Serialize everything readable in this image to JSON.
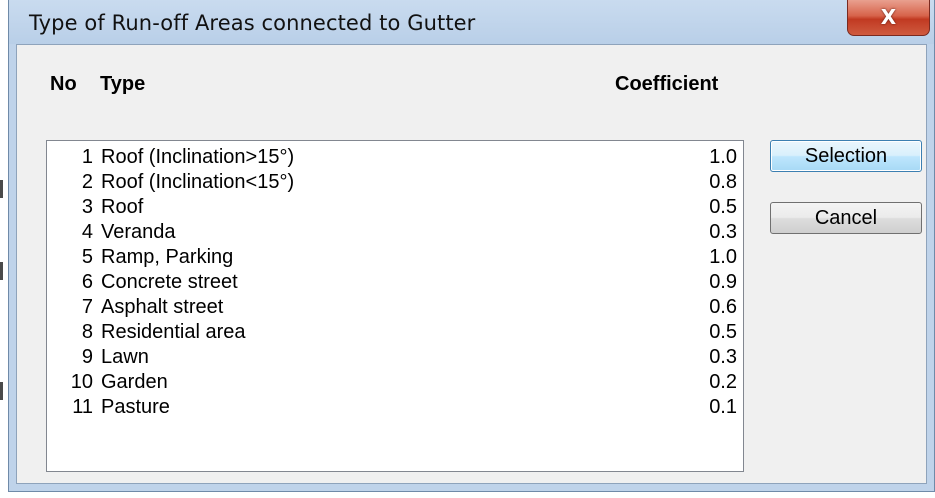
{
  "window": {
    "title": "Type of Run-off Areas connected to Gutter",
    "close_glyph": "X"
  },
  "table": {
    "headers": {
      "no": "No",
      "type": "Type",
      "coefficient": "Coefficient"
    },
    "rows": [
      {
        "no": "1",
        "type": "Roof (Inclination>15°)",
        "coefficient": "1.0"
      },
      {
        "no": "2",
        "type": "Roof (Inclination<15°)",
        "coefficient": "0.8"
      },
      {
        "no": "3",
        "type": "Roof",
        "coefficient": "0.5"
      },
      {
        "no": "4",
        "type": "Veranda",
        "coefficient": "0.3"
      },
      {
        "no": "5",
        "type": "Ramp, Parking",
        "coefficient": "1.0"
      },
      {
        "no": "6",
        "type": "Concrete street",
        "coefficient": "0.9"
      },
      {
        "no": "7",
        "type": "Asphalt street",
        "coefficient": "0.6"
      },
      {
        "no": "8",
        "type": "Residential area",
        "coefficient": "0.5"
      },
      {
        "no": "9",
        "type": "Lawn",
        "coefficient": "0.3"
      },
      {
        "no": "10",
        "type": "Garden",
        "coefficient": "0.2"
      },
      {
        "no": "11",
        "type": "Pasture",
        "coefficient": "0.1"
      }
    ]
  },
  "buttons": {
    "selection": "Selection",
    "cancel": "Cancel"
  },
  "icons": {
    "close": "close-icon"
  },
  "colors": {
    "frame": "#bfd3ea",
    "client": "#f0f0f0",
    "close_button": "#c13a22",
    "default_button_border": "#3c7fb1"
  }
}
